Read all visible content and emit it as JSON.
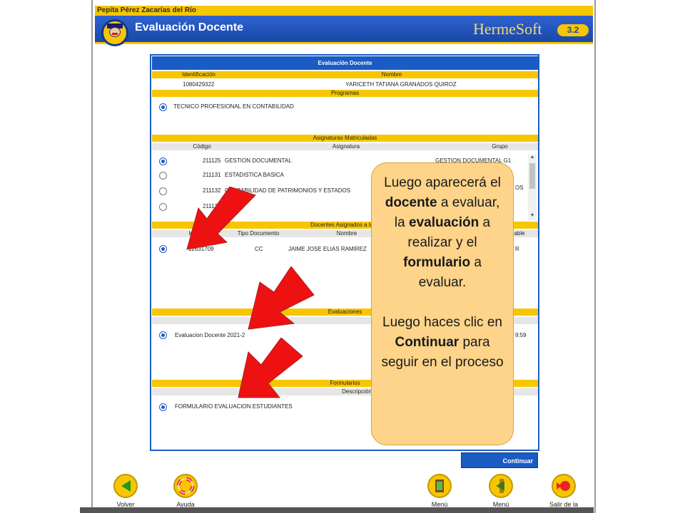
{
  "user_bar": {
    "name": "Pepita Pérez Zacarías del Río"
  },
  "header": {
    "title": "Evaluación Docente",
    "brand": "HermeSoft",
    "version": "3.2"
  },
  "panel": {
    "title": "Evaluación Docente",
    "student_headers": {
      "id": "Identificación",
      "name": "Nombre"
    },
    "student": {
      "id": "1080429322",
      "name": "YARICETH TATIANA GRANADOS QUIROZ"
    },
    "programs_header": "Programas",
    "program": "TECNICO PROFESIONAL EN CONTABILIDAD",
    "subjects_header": "Asignaturas Matriculadas",
    "subject_cols": {
      "code": "Código",
      "subject": "Asignatura",
      "group": "Grupo"
    },
    "subjects": [
      {
        "code": "211125",
        "name": "GESTION DOCUMENTAL",
        "group": "GESTION DOCUMENTAL G1",
        "selected": true
      },
      {
        "code": "211131",
        "name": "ESTADISTICA BASICA",
        "group": "",
        "selected": false
      },
      {
        "code": "211132",
        "name": "CONTABILIDAD DE PATRIMONIOS Y ESTADOS",
        "group": "OS",
        "selected": false
      },
      {
        "code": "21113",
        "name": "",
        "group": "",
        "selected": false
      }
    ],
    "teachers_header": "Docentes Asignados a la M",
    "teacher_cols": {
      "id": "Iden",
      "doc_type": "Tipo Documento",
      "name": "Nombre",
      "resp": "able"
    },
    "teacher": {
      "id": "12631709",
      "doc_type": "CC",
      "name": "JAIME JOSE ELIAS RAMIREZ",
      "resp": "R"
    },
    "evaluations_header": "Evaluaciones",
    "evaluation_col": "ón",
    "evaluation": {
      "name": "Evaluacion Docente 2021-2",
      "end": "9:59"
    },
    "forms_header": "Formularios",
    "form_col": "Descripción",
    "form": "FORMULARIO EVALUACION ESTUDIANTES"
  },
  "continue_label": "Continuar",
  "footer": [
    {
      "label": "Volver",
      "icon": "back-arrow-icon"
    },
    {
      "label": "Ayuda",
      "icon": "lifebuoy-icon"
    },
    {
      "label": "Menú",
      "icon": "menu-icon"
    },
    {
      "label": "Menú",
      "icon": "menu-back-icon"
    },
    {
      "label": "Salir de la",
      "icon": "exit-icon"
    }
  ],
  "callout": {
    "line1": "Luego aparecerá el",
    "b1": "docente",
    "t1": "a evaluar, la",
    "b2": "evaluación",
    "t2": "a realizar y el",
    "b3": "formulario",
    "t3": "a evaluar.",
    "line2": "Luego haces clic en",
    "b4": "Continuar",
    "t4": "para seguir en el proceso"
  },
  "colors": {
    "brand_blue": "#1a5bc4",
    "brand_yellow": "#f7c600",
    "callout": "#fdd48a",
    "arrow": "#ee1111"
  }
}
